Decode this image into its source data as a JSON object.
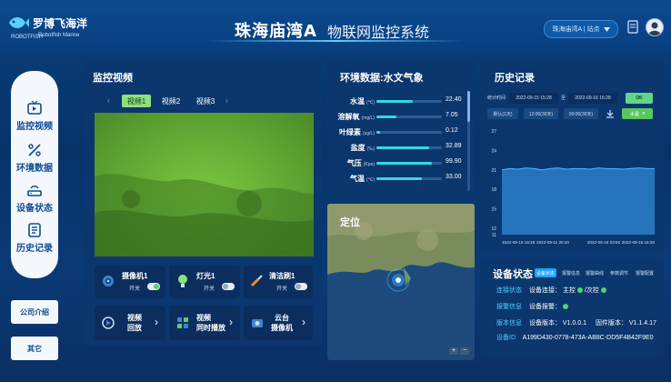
{
  "brand": {
    "name_cn": "罗博飞海洋",
    "name_en": "Robotfish Marine",
    "logo_sub": "ROBOTFISH"
  },
  "header": {
    "title_main": "珠海庙湾A",
    "title_sub": "物联网监控系统",
    "site_selector": "珠海庙湾A | 站点"
  },
  "nav": {
    "items": [
      {
        "label": "监控视频",
        "icon": "tv-icon"
      },
      {
        "label": "环境数据",
        "icon": "percent-chart-icon"
      },
      {
        "label": "设备状态",
        "icon": "router-icon"
      },
      {
        "label": "历史记录",
        "icon": "history-list-icon"
      }
    ],
    "company": "公司介绍",
    "other": "其它"
  },
  "video": {
    "title": "监控视频",
    "tabs": [
      "视频1",
      "视频2",
      "视频3"
    ],
    "controls": [
      {
        "name": "摄像机1",
        "state": "开关"
      },
      {
        "name": "灯光1",
        "state": "开关"
      },
      {
        "name": "清洁刷1",
        "state": "开关"
      }
    ],
    "actions": [
      {
        "line1": "视频",
        "line2": "回放"
      },
      {
        "line1": "视频",
        "line2": "同时播放"
      },
      {
        "line1": "云台",
        "line2": "摄像机"
      }
    ]
  },
  "env": {
    "title": "环境数据:水文气象",
    "rows": [
      {
        "label": "水温",
        "unit": "(℃)",
        "value": "22.40",
        "fill": 0.55
      },
      {
        "label": "溶解氧",
        "unit": "(mg/L)",
        "value": "7.05",
        "fill": 0.3
      },
      {
        "label": "叶绿素",
        "unit": "(ug/L)",
        "value": "0.12",
        "fill": 0.05
      },
      {
        "label": "盐度",
        "unit": "(‰)",
        "value": "32.89",
        "fill": 0.8
      },
      {
        "label": "气压",
        "unit": "(Kpa)",
        "value": "99.90",
        "fill": 0.85
      },
      {
        "label": "气温",
        "unit": "(℃)",
        "value": "33.00",
        "fill": 0.7
      }
    ]
  },
  "map": {
    "title": "定位"
  },
  "history": {
    "title": "历史记录",
    "range_label": "统计时间",
    "start": "2022-09-15 15:28",
    "to": "至",
    "end": "2022-09-16 15:28",
    "ok": "OK",
    "opt1": "默认(1天)",
    "opt2": "12:00(30天)",
    "opt3": "00:00(30天)",
    "metric": "水温",
    "yticks": [
      "27",
      "24",
      "21",
      "18",
      "15",
      "12",
      "11"
    ],
    "xticks": [
      "1522-09-15 15:28",
      "2022-09-11 20:40",
      "2022-09-16 03:50",
      "2022-09-16 15:28"
    ]
  },
  "chart_data": {
    "type": "area",
    "ylim": [
      11,
      27
    ],
    "x": [
      "1522-09-15 15:28",
      "2022-09-11 20:40",
      "2022-09-16 03:50",
      "2022-09-16 15:28"
    ],
    "series": [
      {
        "values": [
          21.0,
          21.2,
          21.1,
          21.3,
          21.2,
          21.0,
          21.2,
          21.3,
          21.1,
          21.2,
          21.2,
          21.1,
          21.3,
          21.2,
          21.2,
          21.1,
          21.2,
          21.3,
          21.2,
          21.2
        ]
      }
    ],
    "color": "#2a7fc9"
  },
  "device": {
    "title": "设备状态",
    "tabs": [
      "设备状态",
      "报警信息",
      "报警曲线",
      "参数调节",
      "报警配置"
    ],
    "lines": [
      {
        "key": "连接状态",
        "text": "设备连接： 主控",
        "extra": "/次控"
      },
      {
        "key": "报警信息",
        "text": "设备报警：",
        "extra": ""
      },
      {
        "key": "版本信息",
        "text": "设备版本： V1.0.0.1",
        "extra": "固件版本： V1.1.4.17"
      },
      {
        "key": "设备ID",
        "text": "A199D430-0778-473A-AB8C-DD5F4B42F9E0",
        "extra": ""
      }
    ]
  },
  "colors": {
    "accent": "#34d9e6",
    "ok": "#8ee07e",
    "video_bg": "#6fb63a"
  }
}
